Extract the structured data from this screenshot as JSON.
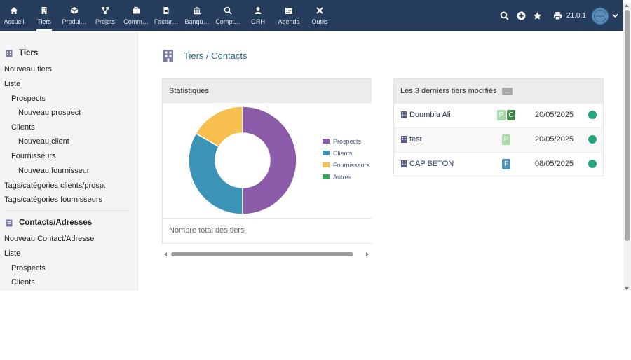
{
  "nav": {
    "items": [
      {
        "label": "Accueil",
        "icon": "home-icon"
      },
      {
        "label": "Tiers",
        "icon": "building-icon"
      },
      {
        "label": "Produi…",
        "icon": "cube-icon"
      },
      {
        "label": "Projets",
        "icon": "project-icon"
      },
      {
        "label": "Comm…",
        "icon": "briefcase-icon"
      },
      {
        "label": "Factur…",
        "icon": "invoice-icon"
      },
      {
        "label": "Banqu…",
        "icon": "bank-icon"
      },
      {
        "label": "Compt…",
        "icon": "accounting-icon"
      },
      {
        "label": "GRH",
        "icon": "user-icon"
      },
      {
        "label": "Agenda",
        "icon": "calendar-icon"
      },
      {
        "label": "Outils",
        "icon": "tools-icon"
      }
    ],
    "active": "Tiers",
    "version": "21.0.1"
  },
  "sidebar": {
    "section1": {
      "title": "Tiers",
      "items": [
        {
          "label": "Nouveau tiers",
          "level": 0
        },
        {
          "label": "Liste",
          "level": 0
        },
        {
          "label": "Prospects",
          "level": 1
        },
        {
          "label": "Nouveau prospect",
          "level": 2
        },
        {
          "label": "Clients",
          "level": 1
        },
        {
          "label": "Nouveau client",
          "level": 2
        },
        {
          "label": "Fournisseurs",
          "level": 1
        },
        {
          "label": "Nouveau fournisseur",
          "level": 2
        },
        {
          "label": "Tags/catégories clients/prosp.",
          "level": 0
        },
        {
          "label": "Tags/catégories fournisseurs",
          "level": 0
        }
      ]
    },
    "section2": {
      "title": "Contacts/Adresses",
      "items": [
        {
          "label": "Nouveau Contact/Adresse",
          "level": 0
        },
        {
          "label": "Liste",
          "level": 0
        },
        {
          "label": "Prospects",
          "level": 1
        },
        {
          "label": "Clients",
          "level": 1
        }
      ]
    }
  },
  "breadcrumb": "Tiers / Contacts",
  "stats": {
    "title": "Statistiques",
    "footer": "Nombre total des tiers"
  },
  "chart_data": {
    "type": "pie",
    "donut": true,
    "title": "",
    "categories": [
      "Prospects",
      "Clients",
      "Fournisseurs",
      "Autres"
    ],
    "values": [
      3,
      2,
      1,
      0
    ],
    "colors": [
      "#8b5aa8",
      "#3b93b8",
      "#f7bf4d",
      "#3ba55c"
    ],
    "legend": "right"
  },
  "recent": {
    "title": "Les 3 derniers tiers modifiés",
    "more": "...",
    "rows": [
      {
        "name": "Doumbia Ali",
        "tags": [
          {
            "letter": "P",
            "color": "#a6d8a8"
          },
          {
            "letter": "C",
            "color": "#3d8a4a"
          }
        ],
        "date": "20/05/2025",
        "status_color": "#25a580"
      },
      {
        "name": "test",
        "tags": [
          {
            "letter": "P",
            "color": "#a6d8a8"
          }
        ],
        "date": "20/05/2025",
        "status_color": "#25a580"
      },
      {
        "name": "CAP BETON",
        "tags": [
          {
            "letter": "F",
            "color": "#4a8fb0"
          }
        ],
        "date": "08/05/2025",
        "status_color": "#25a580"
      }
    ]
  }
}
